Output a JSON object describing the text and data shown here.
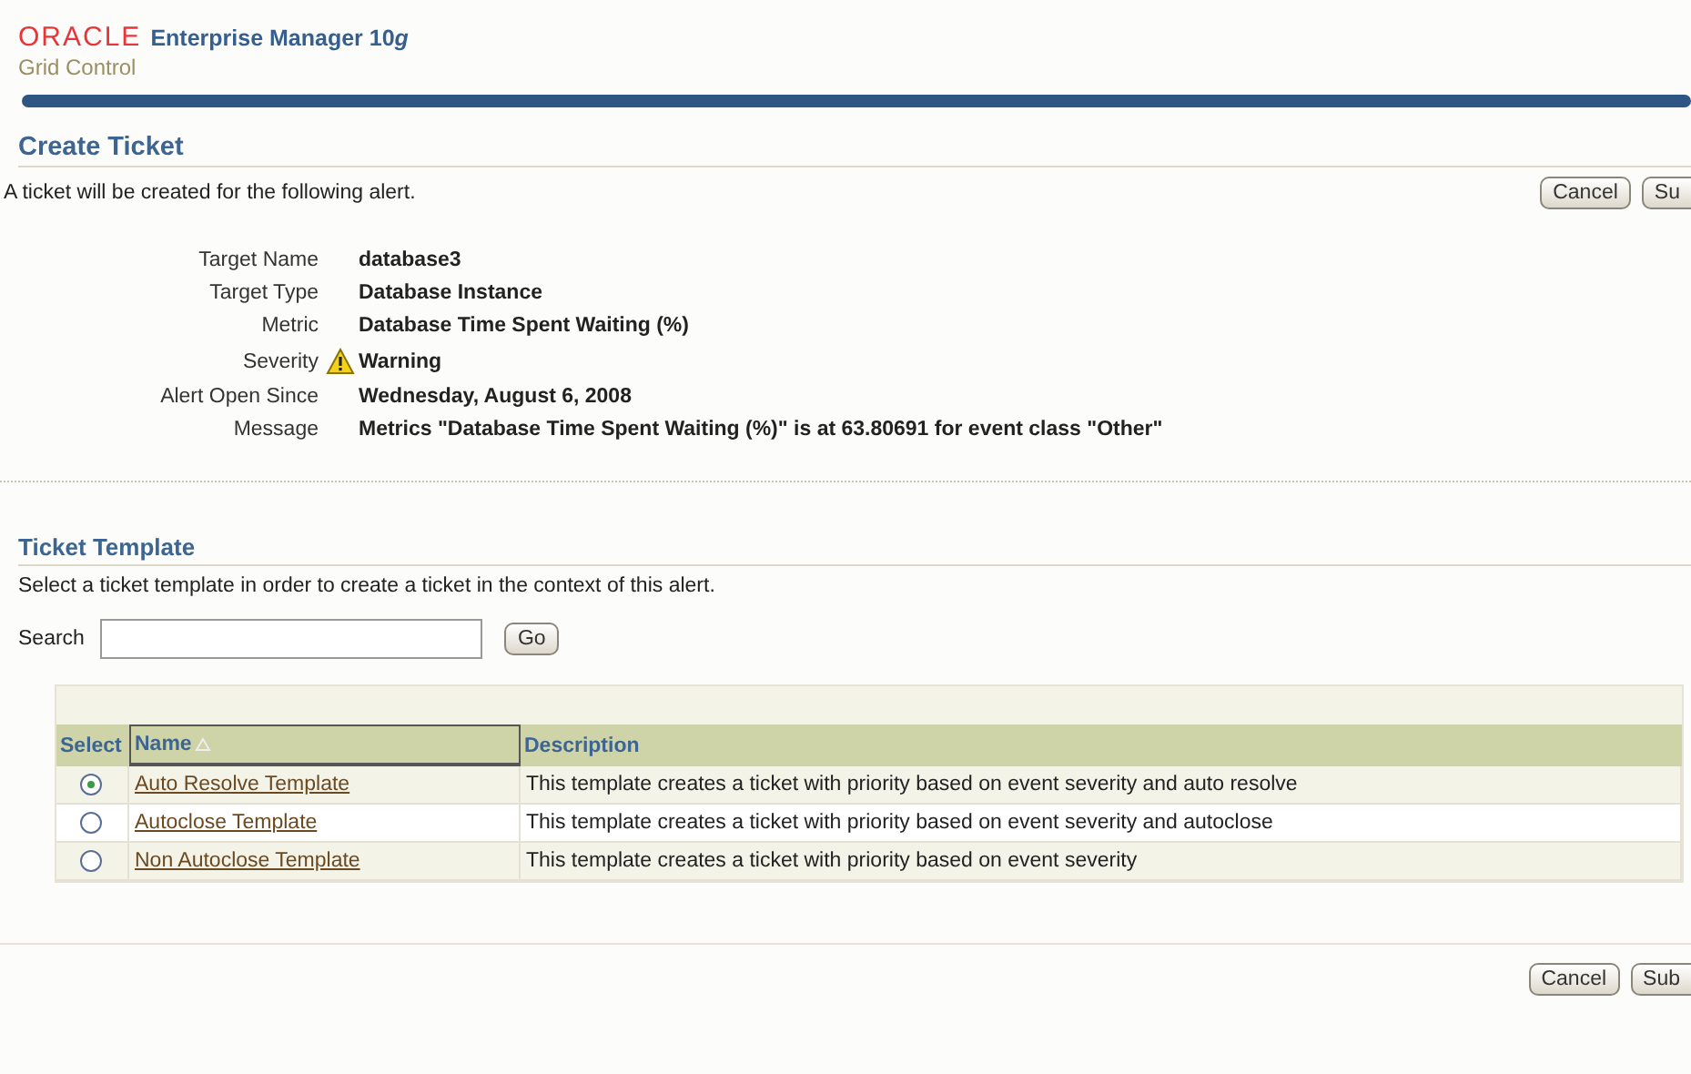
{
  "header": {
    "brand": "ORACLE",
    "product": "Enterprise Manager 10",
    "product_suffix": "g",
    "subtitle": "Grid Control"
  },
  "page": {
    "title": "Create Ticket",
    "description": "A ticket will be created for the following alert."
  },
  "top_buttons": [
    "Cancel",
    "Su"
  ],
  "details": [
    {
      "label": "Target Name",
      "value": "database3",
      "kind": "plain"
    },
    {
      "label": "Target Type",
      "value": "Database Instance",
      "kind": "plain"
    },
    {
      "label": "Metric",
      "value": "Database Time Spent Waiting (%)",
      "kind": "plain"
    },
    {
      "label": "Severity",
      "value": "Warning",
      "kind": "warning"
    },
    {
      "label": "Alert Open Since",
      "value": "Wednesday, August 6, 2008",
      "kind": "plain"
    },
    {
      "label": "Message",
      "value": "Metrics \"Database Time Spent Waiting (%)\" is at 63.80691 for event class \"Other\"",
      "kind": "plain"
    }
  ],
  "template_section": {
    "title": "Ticket Template",
    "description": "Select a ticket template in order to create a ticket in the context of this alert.",
    "search_label": "Search",
    "go_button": "Go"
  },
  "table": {
    "columns": [
      "Select",
      "Name",
      "Description"
    ],
    "rows": [
      {
        "name": "Auto Resolve Template",
        "description": "This template creates a ticket with priority based on event severity and auto resolve",
        "selected": true
      },
      {
        "name": "Autoclose Template",
        "description": "This template creates a ticket with priority based on event severity and autoclose",
        "selected": false
      },
      {
        "name": "Non Autoclose Template",
        "description": "This template creates a ticket with priority based on event severity",
        "selected": false
      }
    ]
  },
  "bottom_buttons": [
    "Cancel",
    "Sub"
  ]
}
